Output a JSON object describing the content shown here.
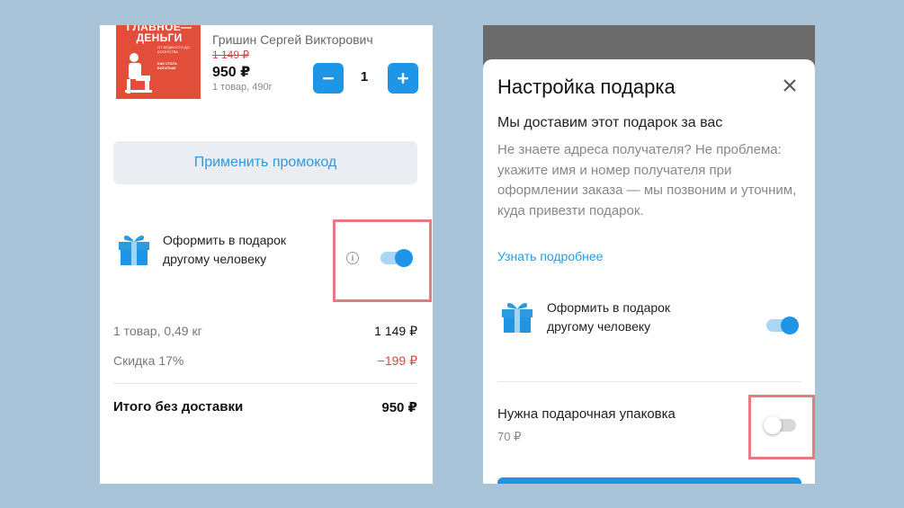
{
  "cart": {
    "book": {
      "cover_title_line1": "ГЛАВНОЕ—",
      "cover_title_line2": "ДЕНЬГИ",
      "cover_subtitle": "ОТ БЕДНОСТИ ДО БОГАТСТВА",
      "cover_tagline": "КАК СТАТЬ БОГАТЫМ",
      "author": "Гришин Сергей Викторович",
      "old_price": "1 149 ₽",
      "price": "950 ₽",
      "meta": "1 товар, 490г",
      "quantity": "1"
    },
    "promo_button": "Применить промокод",
    "gift_option": {
      "label": "Оформить в подарок другому человеку",
      "enabled": true
    },
    "summary": {
      "items_label": "1 товар, 0,49 кг",
      "items_value": "1 149 ₽",
      "discount_label": "Скидка 17%",
      "discount_value": "−199 ₽",
      "total_label": "Итого без доставки",
      "total_value": "950 ₽"
    }
  },
  "gift_settings": {
    "title": "Настройка подарка",
    "deliver_title": "Мы доставим этот подарок за вас",
    "deliver_desc": "Не знаете адреса получателя? Не проблема: укажите имя и номер получателя при оформлении заказа — мы позвоним и уточним, куда привезти подарок.",
    "more_link": "Узнать подробнее",
    "gift_option": {
      "label": "Оформить в подарок другому человеку",
      "enabled": true
    },
    "wrap": {
      "label": "Нужна подарочная упаковка",
      "price": "70 ₽",
      "enabled": false
    }
  },
  "colors": {
    "background": "#a9c4d8",
    "accent": "#1e95e6",
    "highlight": "#e67a80",
    "discount": "#e0444b"
  },
  "icons": [
    "gift-icon",
    "info-icon",
    "close-icon",
    "minus-icon",
    "plus-icon"
  ]
}
